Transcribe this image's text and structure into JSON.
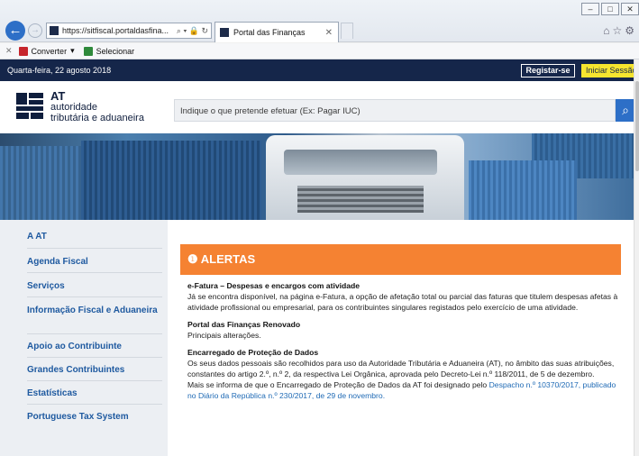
{
  "browser": {
    "url": "https://sitfiscal.portaldasfina...",
    "tab_title": "Portal das Finanças",
    "cmd_convert": "Converter",
    "cmd_select": "Selecionar"
  },
  "topbar": {
    "date": "Quarta-feira, 22 agosto 2018",
    "register": "Registar-se",
    "login": "Iniciar Sessão"
  },
  "header": {
    "logo_line1": "AT",
    "logo_line2": "autoridade",
    "logo_line3": "tributária e aduaneira",
    "search_placeholder": "Indique o que pretende efetuar (Ex: Pagar IUC)"
  },
  "sidebar": {
    "items": [
      {
        "label": "A AT"
      },
      {
        "label": "Agenda Fiscal"
      },
      {
        "label": "Serviços"
      },
      {
        "label": "Informação Fiscal e Aduaneira"
      },
      {
        "label": "Apoio ao Contribuinte"
      },
      {
        "label": "Grandes Contribuintes"
      },
      {
        "label": "Estatísticas"
      },
      {
        "label": "Portuguese Tax System"
      }
    ]
  },
  "alerts": {
    "heading": "ALERTAS",
    "items": [
      {
        "title": "e-Fatura – Despesas e encargos com atividade",
        "text": "Já se encontra disponível, na página e-Fatura, a opção de afetação total ou parcial das faturas que titulem despesas afetas à atividade profissional ou empresarial, para os contribuintes singulares registados pelo exercício de uma atividade."
      },
      {
        "title": "Portal das Finanças Renovado",
        "text": "Principais alterações."
      },
      {
        "title": "Encarregado de Proteção de Dados",
        "text": "Os seus dados pessoais são recolhidos para uso da Autoridade Tributária e Aduaneira (AT), no âmbito das suas atribuições, constantes do artigo 2.º, n.º 2, da respectiva Lei Orgânica, aprovada pelo Decreto-Lei n.º 118/2011, de 5 de dezembro.",
        "text2": "Mais se informa de que o Encarregado de Proteção de Dados da AT foi designado pelo ",
        "link": "Despacho n.º 10370/2017, publicado no Diário da República n.º 230/2017, de 29 de novembro."
      }
    ]
  },
  "colors": {
    "navy": "#15264a",
    "link_blue": "#1f5aa0",
    "alert_orange": "#f58232",
    "login_yellow": "#f6e52f"
  }
}
